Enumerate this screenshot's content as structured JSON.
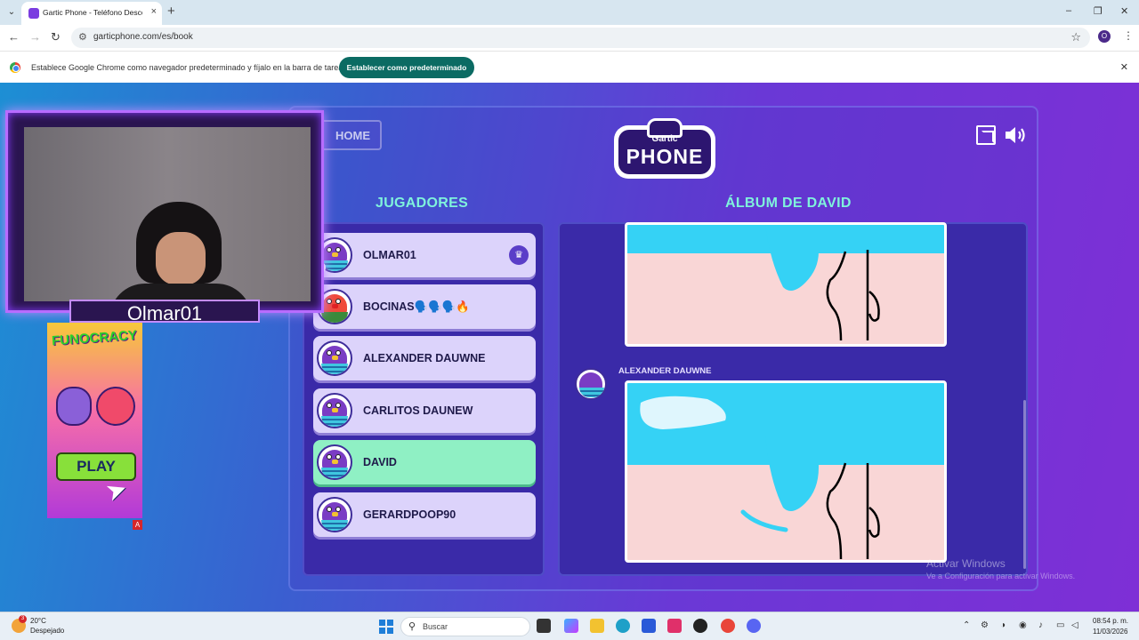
{
  "browser": {
    "tab_title": "Gartic Phone - Teléfono Descon",
    "tab_close": "×",
    "new_tab": "+",
    "url": "garticphone.com/es/book",
    "profile_initial": "O",
    "minimize": "–",
    "restore": "❐",
    "close": "✕"
  },
  "infobar": {
    "message": "Establece Google Chrome como navegador predeterminado y fíjalo en la barra de tareas",
    "button": "Establecer como predeterminado",
    "close": "✕"
  },
  "game": {
    "home_label": "HOME",
    "logo_top": "Gartic",
    "logo_main": "PHONE",
    "players_title": "JUGADORES",
    "album_title": "ÁLBUM DE DAVID",
    "players": [
      {
        "name": "OLMAR01",
        "host": true,
        "active": false
      },
      {
        "name": "BOCINAS🗣️🗣️🗣️🔥",
        "host": false,
        "active": false
      },
      {
        "name": "ALEXANDER DAUWNE",
        "host": false,
        "active": false
      },
      {
        "name": "CARLITOS DAUNEW",
        "host": false,
        "active": false
      },
      {
        "name": "DAVID",
        "host": false,
        "active": true
      },
      {
        "name": "GERARDPOOP90",
        "host": false,
        "active": false
      }
    ],
    "crown_icon": "♛",
    "album_entry_author": "ALEXANDER DAUWNE",
    "colors": {
      "accent": "#7ff3dc",
      "active_player": "#8ff0c4",
      "player": "#dcd3fb",
      "panel": "#3a2aa8"
    }
  },
  "stream": {
    "cam_name": "Olmar01",
    "ad_logo": "FUNOCRACY",
    "ad_play": "PLAY",
    "ad_badge": "A"
  },
  "watermark": {
    "line1": "Activar Windows",
    "line2": "Ve a Configuración para activar Windows."
  },
  "taskbar": {
    "weather_badge": "3",
    "temperature": "20°C",
    "weather": "Despejado",
    "search_placeholder": "Buscar",
    "time": "08:54 p. m.",
    "date": "11/03/2026"
  }
}
